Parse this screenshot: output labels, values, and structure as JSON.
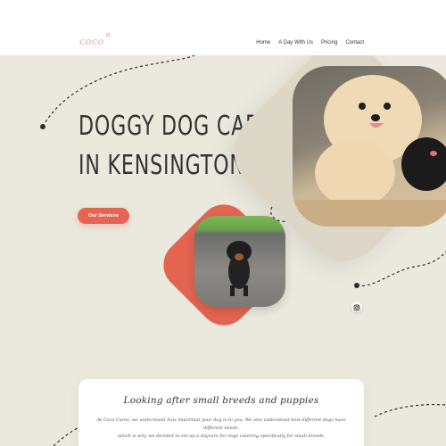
{
  "header": {
    "logo": "coco",
    "logo_mark": "✿",
    "nav": [
      {
        "label": "Home"
      },
      {
        "label": "A Day With Us"
      },
      {
        "label": "Pricing"
      },
      {
        "label": "Contact"
      }
    ]
  },
  "hero": {
    "title_line1": "DOGGY DOG CARE",
    "title_line2": "IN KENSINGTON",
    "cta_label": "Our Services",
    "social_icon": "instagram-icon"
  },
  "card": {
    "title": "Looking after small breeds and puppies",
    "body_line1": "At Coco Cares, we understand how important your dog is to you. We also understand how different dogs have different needs,",
    "body_line2": "which is why we decided to set up a daycare for dogs catering specifically for small breeds."
  },
  "colors": {
    "accent": "#e56552",
    "hero_bg": "#ebe8dd",
    "logo_pink": "#f0a3a0"
  }
}
